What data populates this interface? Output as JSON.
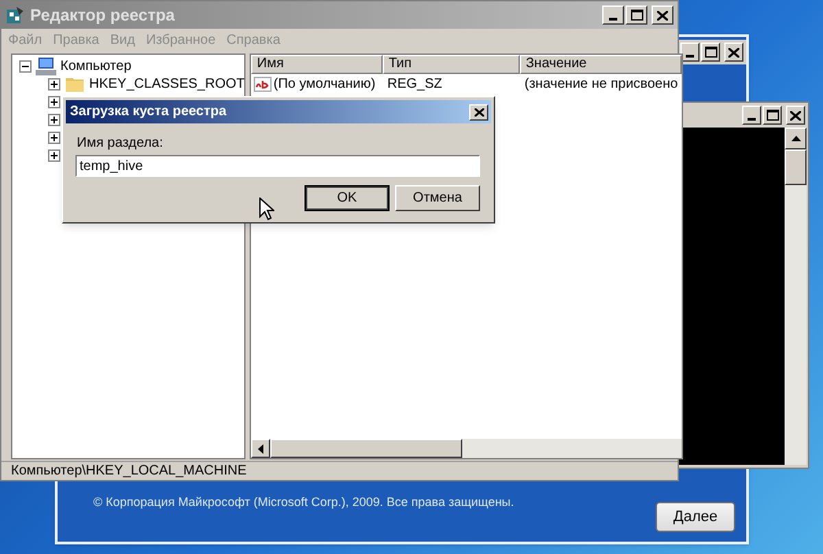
{
  "regedit": {
    "title": "Редактор реестра",
    "menu": [
      "Файл",
      "Правка",
      "Вид",
      "Избранное",
      "Справка"
    ],
    "tree": [
      {
        "label": "Компьютер",
        "expanded": true,
        "children": [
          {
            "label": "HKEY_CLASSES_ROOT",
            "expanded": false
          }
        ]
      }
    ],
    "columns": [
      "Имя",
      "Тип",
      "Значение"
    ],
    "rows": [
      {
        "name": "(По умолчанию)",
        "type": "REG_SZ",
        "value": "(значение не присвоено"
      }
    ],
    "status_bar": "Компьютер\\HKEY_LOCAL_MACHINE"
  },
  "dialog": {
    "title": "Загрузка куста реестра",
    "label": "Имя раздела:",
    "value": "temp_hive",
    "buttons": [
      {
        "label": "OK",
        "default": true
      },
      {
        "label": "Отмена",
        "default": false
      }
    ]
  },
  "setup": {
    "copyright": "© Корпорация Майкрософт (Microsoft Corp.), 2009. Все права защищены.",
    "next_button": "Далее"
  }
}
